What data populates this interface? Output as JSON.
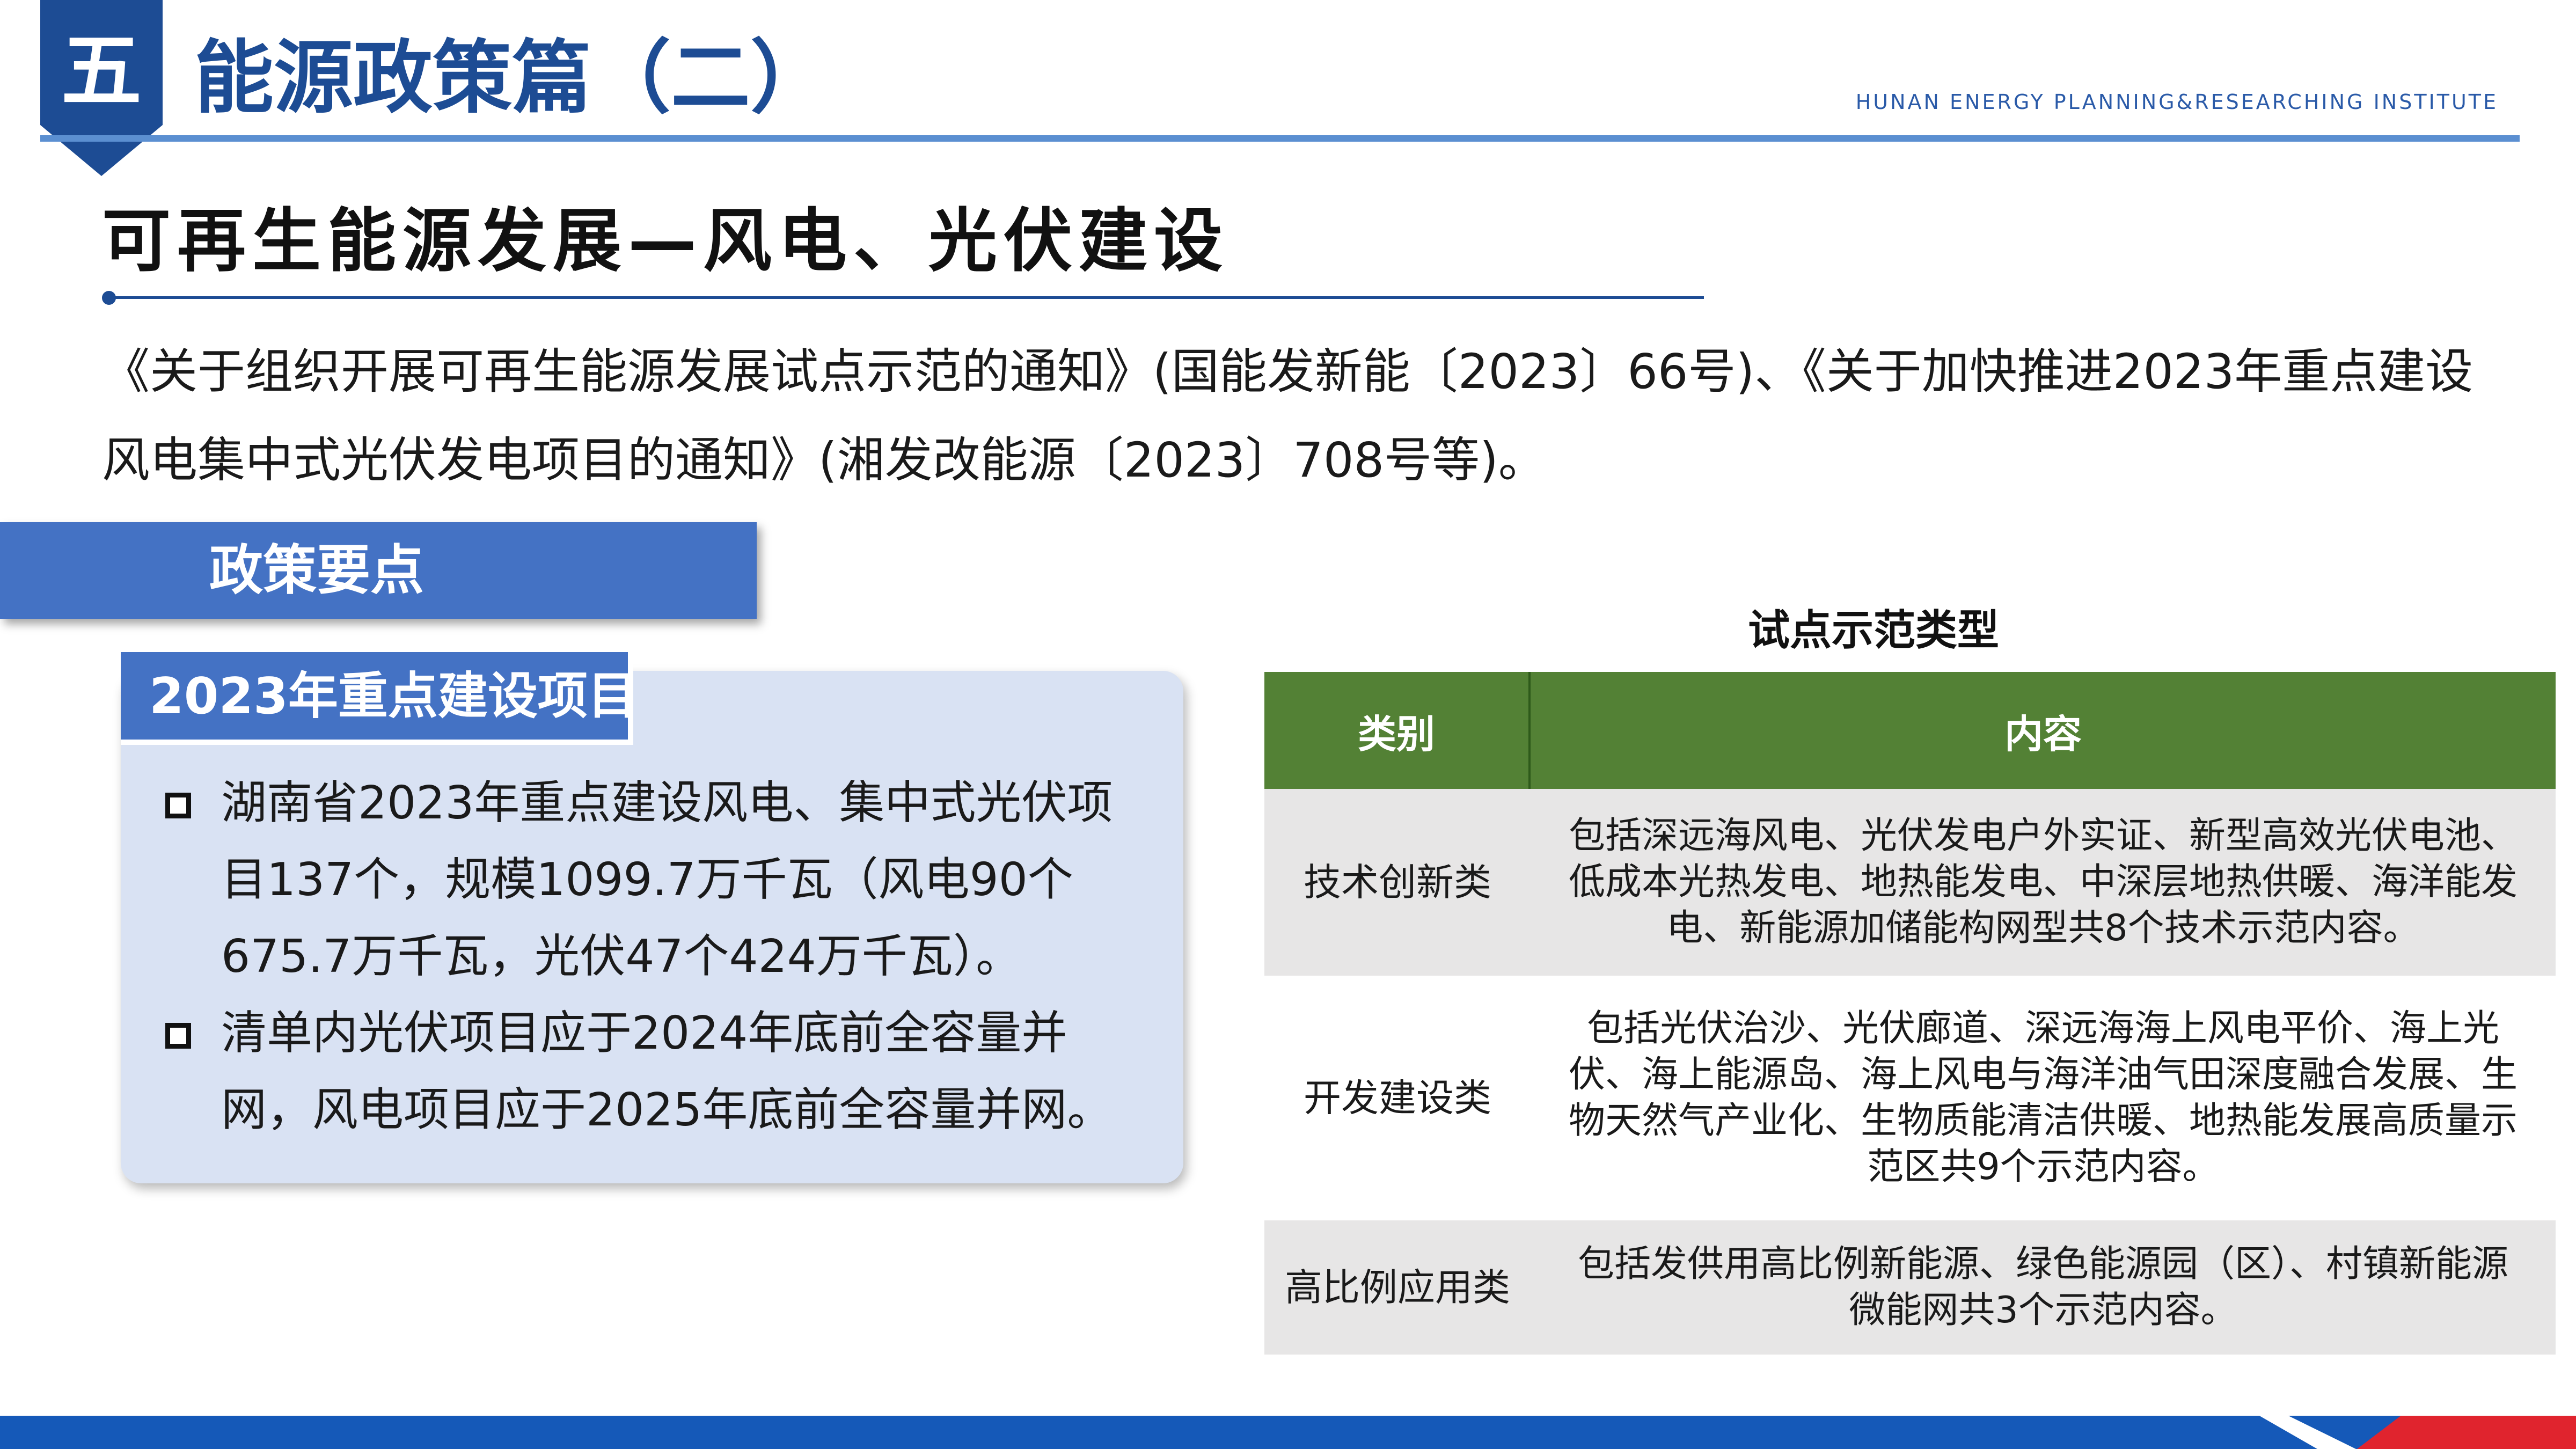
{
  "header": {
    "section_number": "五",
    "title": "能源政策篇（二）",
    "institute": "HUNAN ENERGY PLANNING&RESEARCHING INSTITUTE"
  },
  "subtitle": "可再生能源发展—风电、光伏建设",
  "intro": "《关于组织开展可再生能源发展试点示范的通知》(国能发新能〔2023〕66号)、《关于加快推进2023年重点建设风电集中式光伏发电项目的通知》(湘发改能源〔2023〕708号等)。",
  "policy_label": "政策要点",
  "card": {
    "tab": "2023年重点建设项目",
    "bullets": [
      "湖南省2023年重点建设风电、集中式光伏项目137个，规模1099.7万千瓦（风电90个675.7万千瓦，光伏47个424万千瓦）。",
      "清单内光伏项目应于2024年底前全容量并网，风电项目应于2025年底前全容量并网。"
    ]
  },
  "table": {
    "title": "试点示范类型",
    "headers": [
      "类别",
      "内容"
    ],
    "rows": [
      {
        "category": "技术创新类",
        "content": "包括深远海风电、光伏发电户外实证、新型高效光伏电池、低成本光热发电、地热能发电、中深层地热供暖、海洋能发电、新能源加储能构网型共8个技术示范内容。"
      },
      {
        "category": "开发建设类",
        "content": "包括光伏治沙、光伏廊道、深远海海上风电平价、海上光伏、海上能源岛、海上风电与海洋油气田深度融合发展、生物天然气产业化、生物质能清洁供暖、地热能发展高质量示范区共9个示范内容。"
      },
      {
        "category": "高比例应用类",
        "content": "包括发供用高比例新能源、绿色能源园（区）、村镇新能源微能网共3个示范内容。"
      }
    ]
  },
  "colors": {
    "brand_blue": "#1d4c94",
    "accent_blue": "#4472c4",
    "table_header_green": "#538135",
    "footer_red": "#e0242e"
  }
}
